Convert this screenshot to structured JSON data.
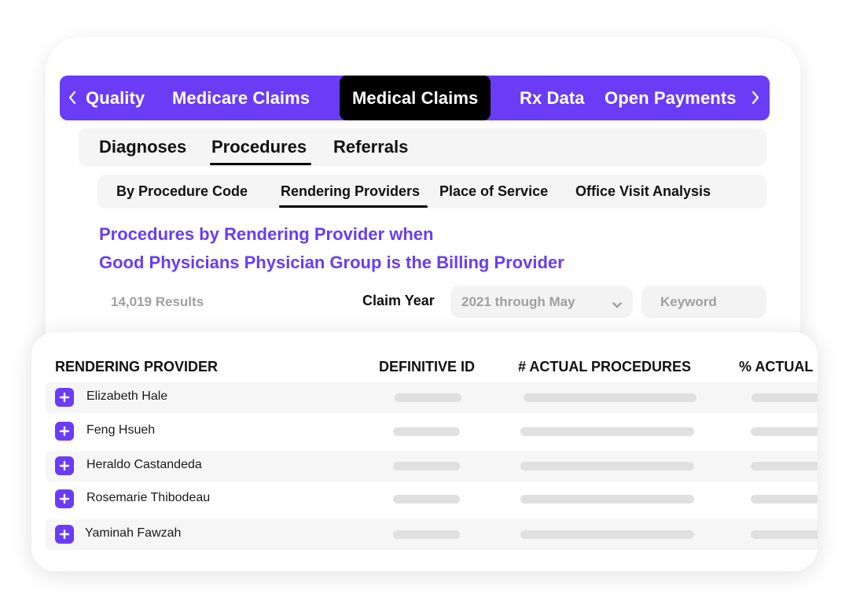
{
  "nav": {
    "tabs": [
      {
        "label": "Quality"
      },
      {
        "label": "Medicare Claims"
      },
      {
        "label": "Medical Claims",
        "active": true
      },
      {
        "label": "Rx Data"
      },
      {
        "label": "Open Payments"
      }
    ],
    "prev_icon": "chevron-left-icon",
    "next_icon": "chevron-right-icon"
  },
  "subnav": {
    "tabs": [
      {
        "label": "Diagnoses"
      },
      {
        "label": "Procedures",
        "active": true
      },
      {
        "label": "Referrals"
      }
    ]
  },
  "subnav2": {
    "tabs": [
      {
        "label": "By Procedure Code"
      },
      {
        "label": "Rendering Providers",
        "active": true
      },
      {
        "label": "Place of Service"
      },
      {
        "label": "Office Visit Analysis"
      }
    ]
  },
  "heading": {
    "line1": "Procedures by Rendering Provider when",
    "line2": "Good Physicians Physician Group is the Billing Provider"
  },
  "filters": {
    "results": "14,019 Results",
    "claim_year_label": "Claim Year",
    "claim_year_value": "2021 through May",
    "keyword_placeholder": "Keyword"
  },
  "table": {
    "columns": [
      "RENDERING PROVIDER",
      "DEFINITIVE ID",
      "# ACTUAL PROCEDURES",
      "% ACTUAL"
    ],
    "rows": [
      {
        "name": "Elizabeth Hale"
      },
      {
        "name": "Feng Hsueh"
      },
      {
        "name": "Heraldo Castandeda"
      },
      {
        "name": "Rosemarie Thibodeau"
      },
      {
        "name": "Yaminah Fawzah"
      }
    ]
  },
  "colors": {
    "accent": "#6a3cf5",
    "active_tab": "#000000",
    "muted_text": "#a0a0a0",
    "skeleton": "#e0e0e0"
  }
}
